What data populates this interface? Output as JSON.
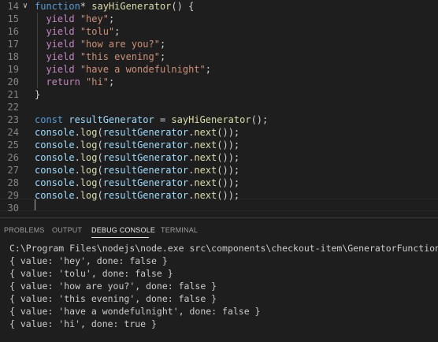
{
  "editor": {
    "lines": [
      {
        "num": "14",
        "tokens": [
          {
            "c": "t-kw2",
            "t": "function"
          },
          {
            "c": "t-pun",
            "t": "* "
          },
          {
            "c": "t-fn",
            "t": "sayHiGenerator"
          },
          {
            "c": "t-pun",
            "t": "() {"
          }
        ]
      },
      {
        "num": "15",
        "tokens": [
          {
            "c": "t-pun",
            "t": "  "
          },
          {
            "c": "t-kw",
            "t": "yield"
          },
          {
            "c": "t-pun",
            "t": " "
          },
          {
            "c": "t-str",
            "t": "\"hey\""
          },
          {
            "c": "t-pun",
            "t": ";"
          }
        ]
      },
      {
        "num": "16",
        "tokens": [
          {
            "c": "t-pun",
            "t": "  "
          },
          {
            "c": "t-kw",
            "t": "yield"
          },
          {
            "c": "t-pun",
            "t": " "
          },
          {
            "c": "t-str",
            "t": "\"tolu\""
          },
          {
            "c": "t-pun",
            "t": ";"
          }
        ]
      },
      {
        "num": "17",
        "tokens": [
          {
            "c": "t-pun",
            "t": "  "
          },
          {
            "c": "t-kw",
            "t": "yield"
          },
          {
            "c": "t-pun",
            "t": " "
          },
          {
            "c": "t-str",
            "t": "\"how are you?\""
          },
          {
            "c": "t-pun",
            "t": ";"
          }
        ]
      },
      {
        "num": "18",
        "tokens": [
          {
            "c": "t-pun",
            "t": "  "
          },
          {
            "c": "t-kw",
            "t": "yield"
          },
          {
            "c": "t-pun",
            "t": " "
          },
          {
            "c": "t-str",
            "t": "\"this evening\""
          },
          {
            "c": "t-pun",
            "t": ";"
          }
        ]
      },
      {
        "num": "19",
        "tokens": [
          {
            "c": "t-pun",
            "t": "  "
          },
          {
            "c": "t-kw",
            "t": "yield"
          },
          {
            "c": "t-pun",
            "t": " "
          },
          {
            "c": "t-str",
            "t": "\"have a wondefulnight\""
          },
          {
            "c": "t-pun",
            "t": ";"
          }
        ]
      },
      {
        "num": "20",
        "tokens": [
          {
            "c": "t-pun",
            "t": "  "
          },
          {
            "c": "t-kw",
            "t": "return"
          },
          {
            "c": "t-pun",
            "t": " "
          },
          {
            "c": "t-str",
            "t": "\"hi\""
          },
          {
            "c": "t-pun",
            "t": ";"
          }
        ]
      },
      {
        "num": "21",
        "tokens": [
          {
            "c": "t-pun",
            "t": "}"
          }
        ]
      },
      {
        "num": "22",
        "tokens": []
      },
      {
        "num": "23",
        "tokens": [
          {
            "c": "t-kw2",
            "t": "const"
          },
          {
            "c": "t-pun",
            "t": " "
          },
          {
            "c": "t-var",
            "t": "resultGenerator"
          },
          {
            "c": "t-pun",
            "t": " = "
          },
          {
            "c": "t-fn",
            "t": "sayHiGenerator"
          },
          {
            "c": "t-pun",
            "t": "();"
          }
        ]
      },
      {
        "num": "24",
        "tokens": [
          {
            "c": "t-var",
            "t": "console"
          },
          {
            "c": "t-pun",
            "t": "."
          },
          {
            "c": "t-fn",
            "t": "log"
          },
          {
            "c": "t-pun",
            "t": "("
          },
          {
            "c": "t-var",
            "t": "resultGenerator"
          },
          {
            "c": "t-pun",
            "t": "."
          },
          {
            "c": "t-fn",
            "t": "next"
          },
          {
            "c": "t-pun",
            "t": "());"
          }
        ]
      },
      {
        "num": "25",
        "tokens": [
          {
            "c": "t-var",
            "t": "console"
          },
          {
            "c": "t-pun",
            "t": "."
          },
          {
            "c": "t-fn",
            "t": "log"
          },
          {
            "c": "t-pun",
            "t": "("
          },
          {
            "c": "t-var",
            "t": "resultGenerator"
          },
          {
            "c": "t-pun",
            "t": "."
          },
          {
            "c": "t-fn",
            "t": "next"
          },
          {
            "c": "t-pun",
            "t": "());"
          }
        ]
      },
      {
        "num": "26",
        "tokens": [
          {
            "c": "t-var",
            "t": "console"
          },
          {
            "c": "t-pun",
            "t": "."
          },
          {
            "c": "t-fn",
            "t": "log"
          },
          {
            "c": "t-pun",
            "t": "("
          },
          {
            "c": "t-var",
            "t": "resultGenerator"
          },
          {
            "c": "t-pun",
            "t": "."
          },
          {
            "c": "t-fn",
            "t": "next"
          },
          {
            "c": "t-pun",
            "t": "());"
          }
        ]
      },
      {
        "num": "27",
        "tokens": [
          {
            "c": "t-var",
            "t": "console"
          },
          {
            "c": "t-pun",
            "t": "."
          },
          {
            "c": "t-fn",
            "t": "log"
          },
          {
            "c": "t-pun",
            "t": "("
          },
          {
            "c": "t-var",
            "t": "resultGenerator"
          },
          {
            "c": "t-pun",
            "t": "."
          },
          {
            "c": "t-fn",
            "t": "next"
          },
          {
            "c": "t-pun",
            "t": "());"
          }
        ]
      },
      {
        "num": "28",
        "tokens": [
          {
            "c": "t-var",
            "t": "console"
          },
          {
            "c": "t-pun",
            "t": "."
          },
          {
            "c": "t-fn",
            "t": "log"
          },
          {
            "c": "t-pun",
            "t": "("
          },
          {
            "c": "t-var",
            "t": "resultGenerator"
          },
          {
            "c": "t-pun",
            "t": "."
          },
          {
            "c": "t-fn",
            "t": "next"
          },
          {
            "c": "t-pun",
            "t": "());"
          }
        ]
      },
      {
        "num": "29",
        "tokens": [
          {
            "c": "t-var",
            "t": "console"
          },
          {
            "c": "t-pun",
            "t": "."
          },
          {
            "c": "t-fn",
            "t": "log"
          },
          {
            "c": "t-pun",
            "t": "("
          },
          {
            "c": "t-var",
            "t": "resultGenerator"
          },
          {
            "c": "t-pun",
            "t": "."
          },
          {
            "c": "t-fn",
            "t": "next"
          },
          {
            "c": "t-pun",
            "t": "());"
          }
        ]
      },
      {
        "num": "30",
        "tokens": []
      }
    ],
    "fold_glyph": "∨"
  },
  "panel": {
    "tabs": [
      "PROBLEMS",
      "OUTPUT",
      "DEBUG CONSOLE",
      "TERMINAL"
    ],
    "active_tab": "DEBUG CONSOLE",
    "console": {
      "command": "C:\\Program Files\\nodejs\\node.exe src\\components\\checkout-item\\GeneratorFunction.js",
      "output": [
        "{ value: 'hey', done: false }",
        "{ value: 'tolu', done: false }",
        "{ value: 'how are you?', done: false }",
        "{ value: 'this evening', done: false }",
        "{ value: 'have a wondefulnight', done: false }",
        "{ value: 'hi', done: true }"
      ]
    }
  },
  "colors": {
    "background": "#1e1e1e",
    "keyword_blue": "#569cd6",
    "keyword_purple": "#c586c0",
    "function_yellow": "#dcdcaa",
    "string_orange": "#ce9178",
    "variable_cyan": "#9cdcfe",
    "line_number_gray": "#858585"
  }
}
